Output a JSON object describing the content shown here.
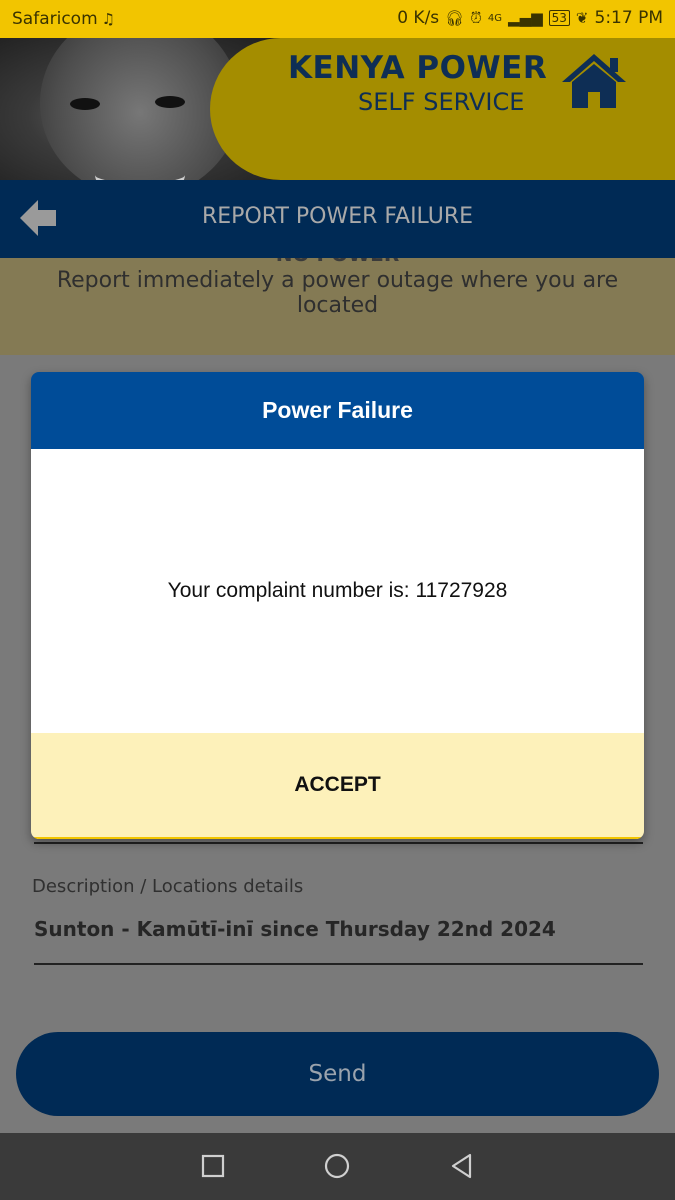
{
  "status_bar": {
    "carrier": "Safaricom",
    "speed": "0 K/s",
    "network": "4G",
    "battery": "53",
    "time": "5:17 PM"
  },
  "banner": {
    "brand_title": "KENYA POWER",
    "brand_subtitle": "SELF SERVICE",
    "home_icon": "home-icon"
  },
  "header": {
    "back_icon": "arrow-left-icon",
    "title": "REPORT POWER FAILURE"
  },
  "info": {
    "heading": "NO POWER",
    "text": "Report immediately a power outage where you are located"
  },
  "form": {
    "description_label": "Description / Locations details",
    "description_value": "Sunton - Kamūtī-inī since Thursday 22nd 2024",
    "send_label": "Send"
  },
  "dialog": {
    "title": "Power Failure",
    "message": "Your complaint number is: 11727928",
    "accept_label": "ACCEPT"
  },
  "nav": {
    "recent_icon": "square-icon",
    "home_icon": "circle-icon",
    "back_icon": "triangle-back-icon"
  },
  "colors": {
    "status_bar": "#f2c500",
    "header": "#002a55",
    "dialog_header": "#004c98",
    "dialog_footer": "#fdf1ba"
  }
}
